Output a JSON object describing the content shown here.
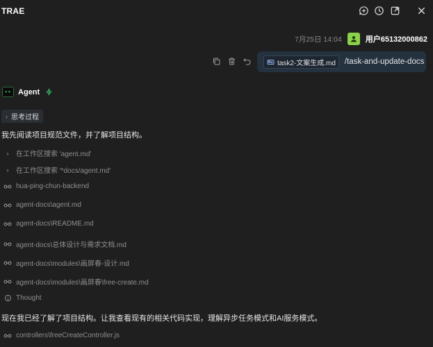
{
  "app": {
    "title": "TRAE"
  },
  "user_message": {
    "time": "7月25日 14:04",
    "username": "用户65132000862",
    "file_chip": "task2-文案生成.md",
    "command": "/task-and-update-docs"
  },
  "agent": {
    "name": "Agent",
    "thinking_label": "思考过程",
    "intro": "我先阅读项目规范文件，并了解项目结构。",
    "searches": [
      "在工作区搜索 'agent.md'",
      "在工作区搜索 '*docs/agent.md'"
    ],
    "files": [
      "hua-ping-chun-backend",
      "agent-docs\\agent.md",
      "agent-docs\\README.md",
      "agent-docs\\总体设计与需求文档.md",
      "agent-docs\\modules\\画屏春-设计.md",
      "agent-docs\\modules\\画屏春\\free-create.md"
    ],
    "thought_label": "Thought",
    "followup": "现在我已经了解了项目结构。让我查看现有的相关代码实现，理解异步任务模式和AI服务模式。",
    "last_file": "controllers\\freeCreateController.js"
  },
  "colors": {
    "accent": "#8bd14a",
    "bubble": "#24313f",
    "background": "#1f1f1f"
  },
  "icons": [
    "new-chat-icon",
    "history-icon",
    "open-external-icon",
    "close-icon",
    "copy-icon",
    "delete-icon",
    "undo-icon",
    "glasses-icon",
    "info-icon",
    "lightning-icon",
    "chevron-right-icon"
  ]
}
